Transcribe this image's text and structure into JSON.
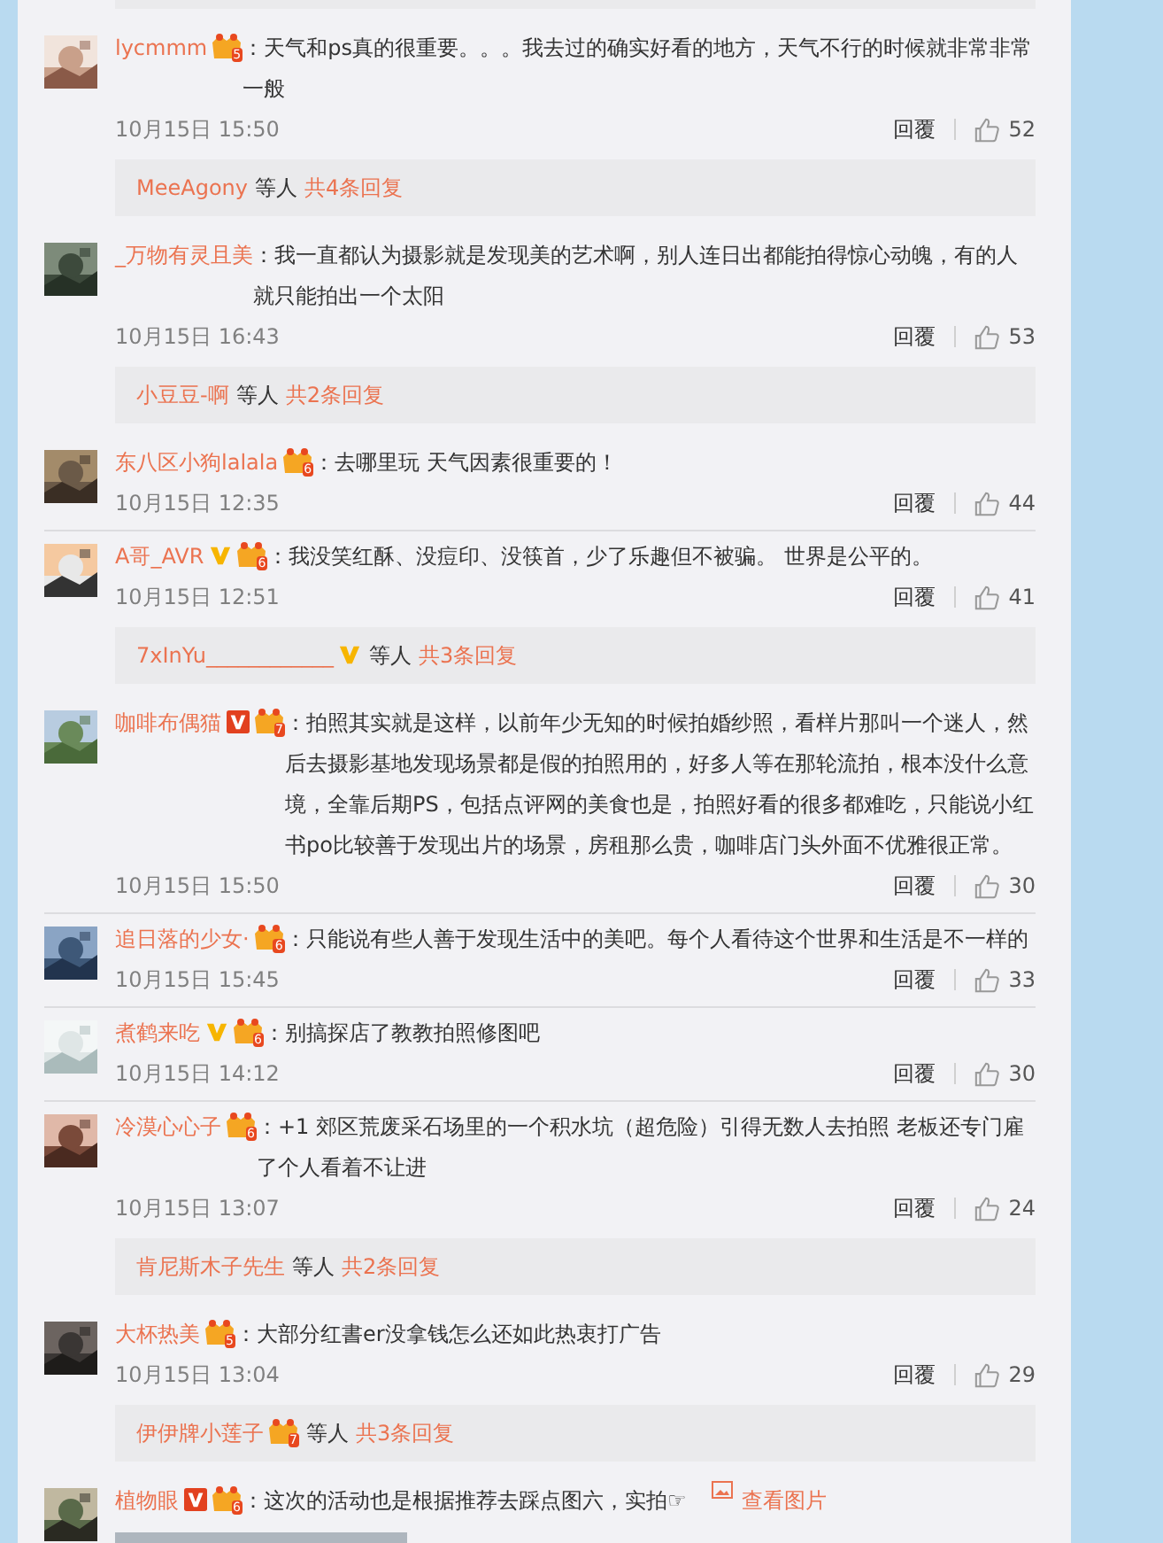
{
  "top_reply_box": {
    "kind": "reply_box"
  },
  "comments": [
    {
      "name": "lycmmm",
      "badges": [
        {
          "kind": "level",
          "label": "5"
        }
      ],
      "text": "：天气和ps真的很重要。。。我去过的确实好看的地方，天气不行的时候就非常非常一般",
      "time": "10月15日 15:50",
      "reply": "回覆",
      "likes": "52",
      "replies": {
        "names": [
          {
            "name": "MeeAgony"
          }
        ],
        "others": "等人",
        "count": "共4条回复"
      }
    },
    {
      "name": "_万物有灵且美",
      "text": "：我一直都认为摄影就是发现美的艺术啊，别人连日出都能拍得惊心动魄，有的人就只能拍出一个太阳",
      "time": "10月15日 16:43",
      "reply": "回覆",
      "likes": "53",
      "replies": {
        "names": [
          {
            "name": "小豆豆-啊"
          }
        ],
        "others": "等人",
        "count": "共2条回复"
      }
    },
    {
      "name": "东八区小狗lalala",
      "badges": [
        {
          "kind": "level",
          "label": "6"
        }
      ],
      "text": "：去哪里玩 天气因素很重要的！",
      "time": "10月15日 12:35",
      "reply": "回覆",
      "likes": "44"
    },
    {
      "name": "A哥_AVR",
      "badges": [
        {
          "kind": "verified"
        },
        {
          "kind": "level",
          "label": "6"
        }
      ],
      "text": "：我没笑红酥、没痘印、没筷首，少了乐趣但不被骗。 世界是公平的。",
      "time": "10月15日 12:51",
      "reply": "回覆",
      "likes": "41",
      "replies": {
        "names": [
          {
            "name": "7xInYu____________",
            "badges": [
              {
                "kind": "verified"
              }
            ]
          }
        ],
        "others": "等人",
        "count": "共3条回复"
      }
    },
    {
      "name": "咖啡布偶猫",
      "badges": [
        {
          "kind": "member"
        },
        {
          "kind": "level",
          "label": "7"
        }
      ],
      "text": "：拍照其实就是这样，以前年少无知的时候拍婚纱照，看样片那叫一个迷人，然后去摄影基地发现场景都是假的拍照用的，好多人等在那轮流拍，根本没什么意境，全靠后期PS，包括点评网的美食也是，拍照好看的很多都难吃，只能说小红书po比较善于发现出片的场景，房租那么贵，咖啡店门头外面不优雅很正常。",
      "time": "10月15日 15:50",
      "reply": "回覆",
      "likes": "30"
    },
    {
      "name": "追日落的少女·",
      "badges": [
        {
          "kind": "level",
          "label": "6"
        }
      ],
      "text": "：只能说有些人善于发现生活中的美吧。每个人看待这个世界和生活是不一样的",
      "time": "10月15日 15:45",
      "reply": "回覆",
      "likes": "33"
    },
    {
      "name": "煮鹤来吃",
      "badges": [
        {
          "kind": "verified"
        },
        {
          "kind": "level",
          "label": "6"
        }
      ],
      "text": "：别搞探店了教教拍照修图吧",
      "time": "10月15日 14:12",
      "reply": "回覆",
      "likes": "30"
    },
    {
      "name": "冷漠心心子",
      "badges": [
        {
          "kind": "level",
          "label": "6"
        }
      ],
      "text": "：+1 郊区荒废采石场里的一个积水坑（超危险）引得无数人去拍照 老板还专门雇了个人看着不让进",
      "time": "10月15日 13:07",
      "reply": "回覆",
      "likes": "24",
      "replies": {
        "names": [
          {
            "name": "肯尼斯木子先生"
          }
        ],
        "others": "等人",
        "count": "共2条回复"
      }
    },
    {
      "name": "大杯热美",
      "badges": [
        {
          "kind": "level",
          "label": "5"
        }
      ],
      "text": "：大部分红書er没拿钱怎么还如此热衷打广告",
      "time": "10月15日 13:04",
      "reply": "回覆",
      "likes": "29",
      "replies": {
        "names": [
          {
            "name": "伊伊牌小莲子",
            "badges": [
              {
                "kind": "level",
                "label": "7"
              }
            ]
          }
        ],
        "others": "等人",
        "count": "共3条回复"
      }
    },
    {
      "name": "植物眼",
      "badges": [
        {
          "kind": "member"
        },
        {
          "kind": "level",
          "label": "6"
        }
      ],
      "text": "：这次的活动也是根据推荐去踩点图六，实拍☞",
      "link": "查看图片"
    }
  ]
}
